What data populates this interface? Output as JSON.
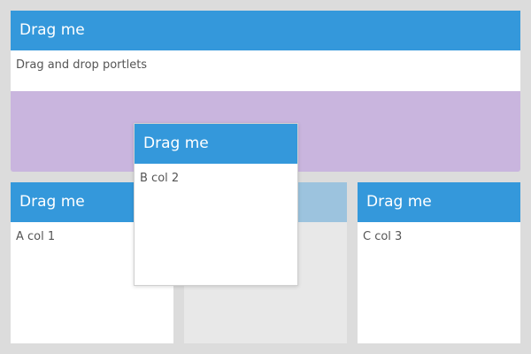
{
  "portlets": {
    "top": {
      "header": "Drag me",
      "body": "Drag and drop portlets"
    },
    "column_a": {
      "header": "Drag me",
      "body": "A col 1"
    },
    "column_c": {
      "header": "Drag me",
      "body": "C col 3"
    },
    "dragging": {
      "header": "Drag me",
      "body": "B col 2"
    }
  },
  "colors": {
    "header": "#3498db",
    "drop_highlight": "#c9b5de",
    "placeholder_header": "#9cc3de",
    "placeholder_body": "#e8e8e8",
    "background": "#dcdcdc"
  }
}
